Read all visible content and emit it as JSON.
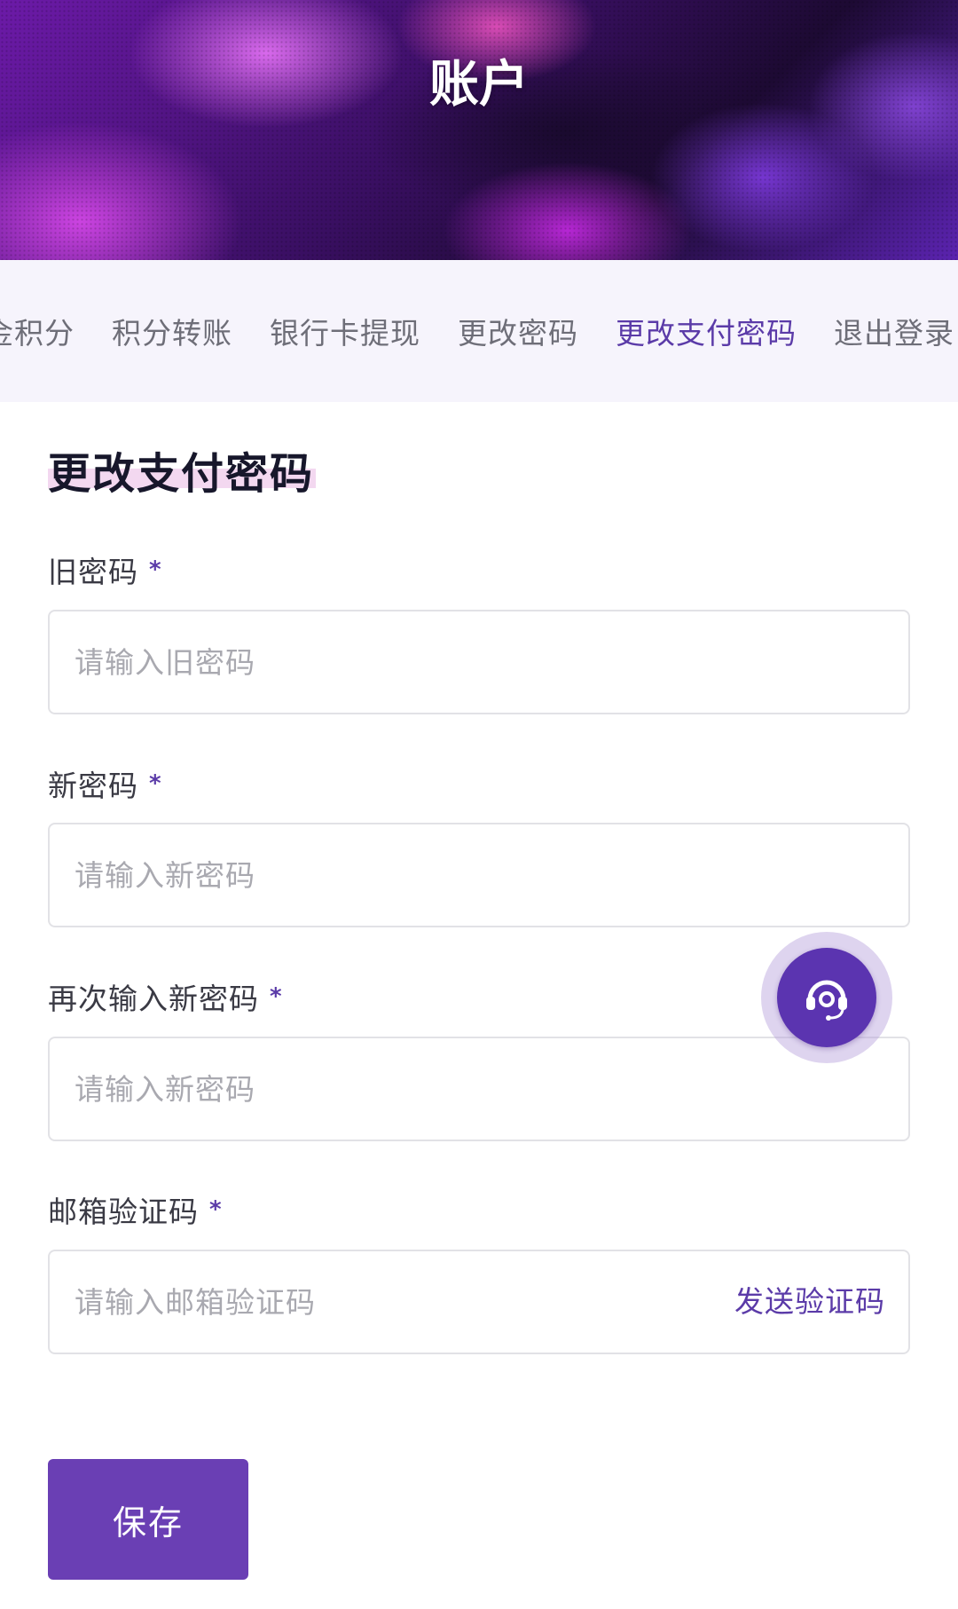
{
  "header": {
    "title": "账户"
  },
  "tabs": [
    {
      "label": "金积分",
      "active": false
    },
    {
      "label": "积分转账",
      "active": false
    },
    {
      "label": "银行卡提现",
      "active": false
    },
    {
      "label": "更改密码",
      "active": false
    },
    {
      "label": "更改支付密码",
      "active": true
    },
    {
      "label": "退出登录",
      "active": false
    }
  ],
  "form": {
    "title": "更改支付密码",
    "required_mark": "*",
    "fields": [
      {
        "label": "旧密码",
        "placeholder": "请输入旧密码",
        "value": ""
      },
      {
        "label": "新密码",
        "placeholder": "请输入新密码",
        "value": ""
      },
      {
        "label": "再次输入新密码",
        "placeholder": "请输入新密码",
        "value": ""
      },
      {
        "label": "邮箱验证码",
        "placeholder": "请输入邮箱验证码",
        "value": "",
        "action": "发送验证码"
      }
    ],
    "save_label": "保存"
  },
  "support": {
    "icon": "headset-icon"
  },
  "colors": {
    "accent": "#5b3ba8",
    "button": "#6a3fb4",
    "tabbar_bg": "#f6f4fc",
    "highlight": "#f3d8f0"
  }
}
